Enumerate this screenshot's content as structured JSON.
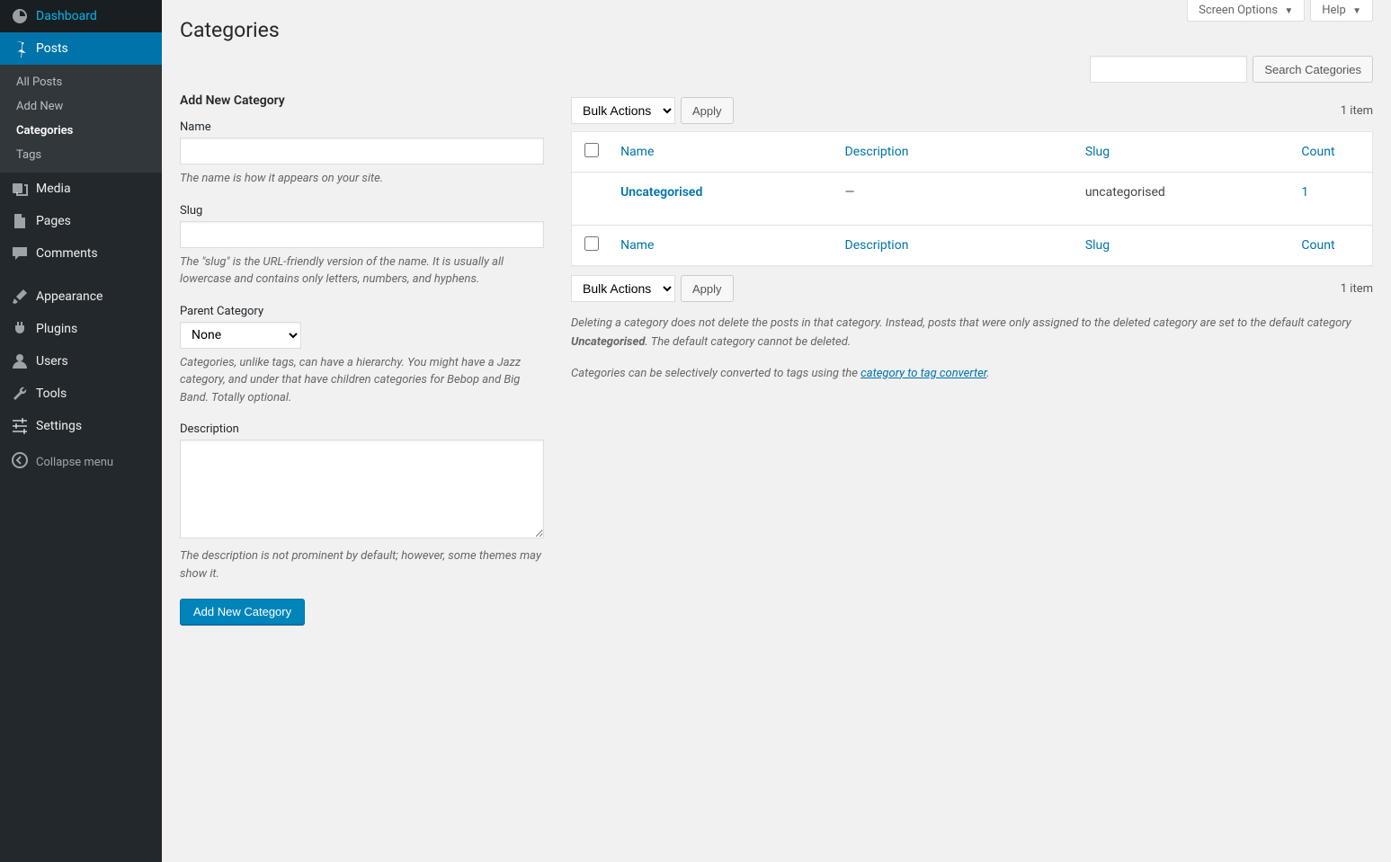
{
  "top": {
    "screen_options": "Screen Options",
    "help": "Help"
  },
  "sidebar": {
    "dashboard": "Dashboard",
    "posts": "Posts",
    "posts_sub": {
      "all": "All Posts",
      "add": "Add New",
      "cats": "Categories",
      "tags": "Tags"
    },
    "media": "Media",
    "pages": "Pages",
    "comments": "Comments",
    "appearance": "Appearance",
    "plugins": "Plugins",
    "users": "Users",
    "tools": "Tools",
    "settings": "Settings",
    "collapse": "Collapse menu"
  },
  "page": {
    "title": "Categories",
    "search_btn": "Search Categories"
  },
  "form": {
    "title": "Add New Category",
    "name_label": "Name",
    "name_desc": "The name is how it appears on your site.",
    "slug_label": "Slug",
    "slug_desc": "The \"slug\" is the URL-friendly version of the name. It is usually all lowercase and contains only letters, numbers, and hyphens.",
    "parent_label": "Parent Category",
    "parent_value": "None",
    "parent_desc": "Categories, unlike tags, can have a hierarchy. You might have a Jazz category, and under that have children categories for Bebop and Big Band. Totally optional.",
    "desc_label": "Description",
    "desc_desc": "The description is not prominent by default; however, some themes may show it.",
    "submit": "Add New Category"
  },
  "table": {
    "bulk": "Bulk Actions",
    "apply": "Apply",
    "items": "1 item",
    "cols": {
      "name": "Name",
      "desc": "Description",
      "slug": "Slug",
      "count": "Count"
    },
    "row": {
      "name": "Uncategorised",
      "desc": "—",
      "slug": "uncategorised",
      "count": "1"
    }
  },
  "notes": {
    "p1a": "Deleting a category does not delete the posts in that category. Instead, posts that were only assigned to the deleted category are set to the default category ",
    "p1b": "Uncategorised",
    "p1c": ". The default category cannot be deleted.",
    "p2a": "Categories can be selectively converted to tags using the ",
    "p2link": "category to tag converter",
    "p2b": "."
  }
}
